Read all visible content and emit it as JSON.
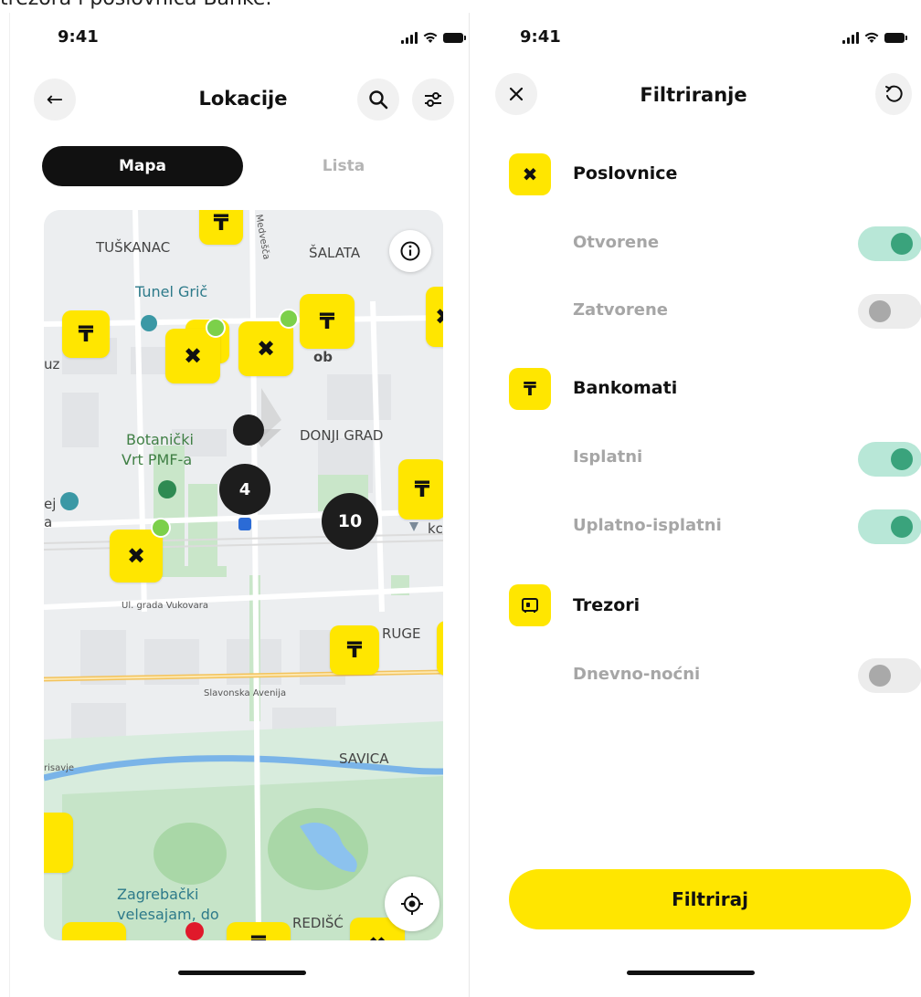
{
  "caption": "trezora i poslovnica Banke.",
  "left": {
    "status": {
      "time": "9:41"
    },
    "title": "Lokacije",
    "back_icon": "←",
    "tabs": [
      {
        "label": "Mapa"
      },
      {
        "label": "Lista"
      }
    ],
    "map": {
      "labels": {
        "tuskanac": "TUŠKANAC",
        "salata": "ŠALATA",
        "tunel": "Tunel Grič",
        "botanicki": "Botanički",
        "vrt": "Vrt PMF-a",
        "donji_grad": "DONJI GRAD",
        "vukovara": "Ul. grada Vukovara",
        "ruge": "RUGE",
        "slavonska": "Slavonska Avenija",
        "savica": "SAVICA",
        "zagrebacki": "Zagrebački",
        "velesajam": "velesajam, do",
        "redisc": "REDIŠĆ",
        "medvescak": "Medvešča",
        "risavje": "risavje",
        "ob": "ob",
        "kc": "kc",
        "uz": "uz",
        "ej": "ej",
        "a": "a"
      },
      "clusters": [
        {
          "count": "4"
        },
        {
          "count": "10"
        }
      ]
    }
  },
  "right": {
    "status": {
      "time": "9:41"
    },
    "title": "Filtriranje",
    "sections": [
      {
        "title": "Poslovnice",
        "icon": "branch-icon",
        "options": [
          {
            "label": "Otvorene",
            "enabled": true
          },
          {
            "label": "Zatvorene",
            "enabled": false
          }
        ]
      },
      {
        "title": "Bankomati",
        "icon": "atm-icon",
        "options": [
          {
            "label": "Isplatni",
            "enabled": true
          },
          {
            "label": "Uplatno-isplatni",
            "enabled": true
          }
        ]
      },
      {
        "title": "Trezori",
        "icon": "vault-icon",
        "options": [
          {
            "label": "Dnevno-noćni",
            "enabled": false
          }
        ]
      }
    ],
    "submit_label": "Filtriraj"
  },
  "colors": {
    "brand_yellow": "#ffe600",
    "toggle_on": "#3aa37c",
    "toggle_on_bg": "#b8e7d7",
    "toggle_off_bg": "#ececec",
    "status_green": "#7cd04a",
    "cluster": "#1d1d1d"
  }
}
